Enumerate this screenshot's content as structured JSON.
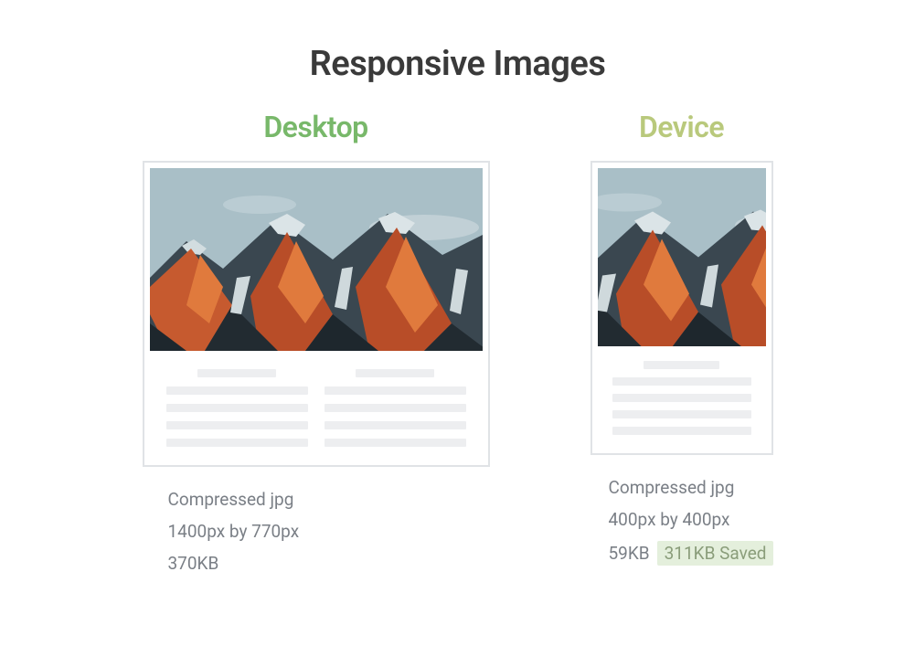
{
  "title": "Responsive Images",
  "desktop": {
    "heading": "Desktop",
    "format": "Compressed jpg",
    "dimensions": "1400px by 770px",
    "size": "370KB"
  },
  "device": {
    "heading": "Device",
    "format": "Compressed jpg",
    "dimensions": "400px by 400px",
    "size": "59KB",
    "saved": "311KB Saved"
  }
}
